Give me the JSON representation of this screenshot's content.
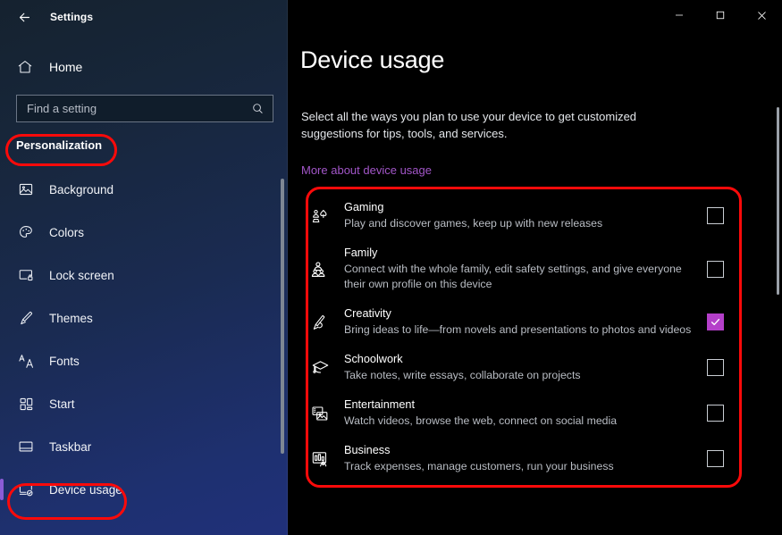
{
  "window": {
    "app_title": "Settings",
    "back_icon": "back-arrow-icon",
    "controls": {
      "minimize": "minimize-icon",
      "maximize": "maximize-icon",
      "close": "close-icon"
    }
  },
  "sidebar": {
    "home": {
      "label": "Home",
      "icon": "home-icon"
    },
    "search": {
      "value": "",
      "placeholder": "Find a setting",
      "icon": "search-icon"
    },
    "section_header": "Personalization",
    "items": [
      {
        "label": "Background",
        "icon": "image-icon",
        "selected": false
      },
      {
        "label": "Colors",
        "icon": "palette-icon",
        "selected": false
      },
      {
        "label": "Lock screen",
        "icon": "lock-screen-icon",
        "selected": false
      },
      {
        "label": "Themes",
        "icon": "brush-icon",
        "selected": false
      },
      {
        "label": "Fonts",
        "icon": "fonts-icon",
        "selected": false
      },
      {
        "label": "Start",
        "icon": "start-icon",
        "selected": false
      },
      {
        "label": "Taskbar",
        "icon": "taskbar-icon",
        "selected": false
      },
      {
        "label": "Device usage",
        "icon": "device-usage-icon",
        "selected": true
      }
    ]
  },
  "main": {
    "title": "Device usage",
    "description": "Select all the ways you plan to use your device to get customized suggestions for tips, tools, and services.",
    "more_link": "More about device usage",
    "options": [
      {
        "title": "Gaming",
        "description": "Play and discover games, keep up with new releases",
        "icon": "gaming-icon",
        "checked": false
      },
      {
        "title": "Family",
        "description": "Connect with the whole family, edit safety settings, and give everyone their own profile on this device",
        "icon": "family-icon",
        "checked": false
      },
      {
        "title": "Creativity",
        "description": "Bring ideas to life—from novels and presentations to photos and videos",
        "icon": "creativity-icon",
        "checked": true
      },
      {
        "title": "Schoolwork",
        "description": "Take notes, write essays, collaborate on projects",
        "icon": "schoolwork-icon",
        "checked": false
      },
      {
        "title": "Entertainment",
        "description": "Watch videos, browse the web, connect on social media",
        "icon": "entertainment-icon",
        "checked": false
      },
      {
        "title": "Business",
        "description": "Track expenses, manage customers, run your business",
        "icon": "business-icon",
        "checked": false
      }
    ]
  },
  "annotations": {
    "color": "#fb0a0a",
    "highlighted": [
      "Personalization",
      "Device usage",
      "device usage options panel"
    ]
  },
  "colors": {
    "accent_purple": "#b43fc9",
    "link_purple": "#a256c8",
    "selection_bar": "#8b5cd6",
    "sidebar_navy": "#1a2b52",
    "main_background": "#000000",
    "annotation_red": "#fb0a0a"
  }
}
